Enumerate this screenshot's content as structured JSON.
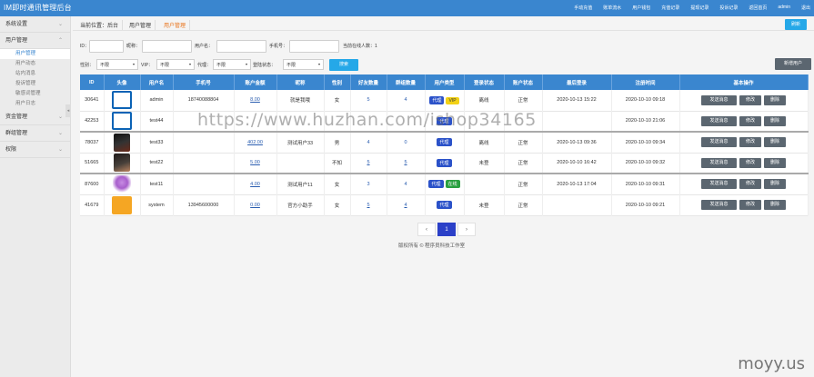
{
  "app": {
    "title": "IM即时通讯管理后台"
  },
  "topnav": [
    "手动充值",
    "账单流水",
    "用户钱包",
    "充值记录",
    "提现记录",
    "投诉记录",
    "返回首页",
    "admin",
    "退出"
  ],
  "sidebar": {
    "groups": [
      {
        "label": "系统设置",
        "chevron": "⌄"
      },
      {
        "label": "用户管理",
        "chevron": "⌃"
      },
      {
        "label": "资金管理",
        "chevron": "⌄"
      },
      {
        "label": "群组管理",
        "chevron": "⌄"
      },
      {
        "label": "权限",
        "chevron": "⌄"
      }
    ],
    "sub_items": [
      "用户管理",
      "用户动态",
      "站内消息",
      "投诉管理",
      "敏感词管理",
      "用户日志"
    ],
    "collapse_arrow": "◂"
  },
  "breadcrumb": [
    "当前位置：后台",
    "用户管理",
    "用户管理"
  ],
  "refresh_label": "刷新",
  "filters": {
    "row1": {
      "id_label": "ID：",
      "nick_label": "昵称：",
      "username_label": "用户名：",
      "phone_label": "手机号：",
      "online_label": "当前在线人数：1"
    },
    "row2": {
      "gender_label": "性别：",
      "gender_value": "不限",
      "vip_label": "VIP：",
      "vip_value": "不限",
      "agent_label": "代理：",
      "agent_value": "不限",
      "status_label": "登陆状态：",
      "status_value": "不限",
      "search_label": "搜索",
      "select_arrow": "▾"
    }
  },
  "add_user_label": "新增用户",
  "table": {
    "headers": [
      "ID",
      "头像",
      "用户名",
      "手机号",
      "账户金额",
      "昵称",
      "性别",
      "好友数量",
      "群组数量",
      "用户类型",
      "登录状态",
      "账户状态",
      "最后登录",
      "注册时间",
      "基本操作"
    ],
    "rows": [
      {
        "id": "30641",
        "avatar": "av-intel",
        "username": "admin",
        "phone": "18740088804",
        "balance": "8.00",
        "nickname": "就是我哦",
        "gender": "女",
        "friends": "5",
        "groups": "4",
        "tags": [
          {
            "t": "代理",
            "c": "blue"
          },
          {
            "t": "VIP",
            "c": "yellow"
          }
        ],
        "login": "离线",
        "account": "正常",
        "last_login": "2020-10-13 15:22",
        "registered": "2020-10-10 09:18",
        "sep": false
      },
      {
        "id": "42253",
        "avatar": "av-intel",
        "username": "test44",
        "phone": "",
        "balance": "",
        "nickname": "",
        "gender": "",
        "friends": "",
        "groups": "",
        "tags": [
          {
            "t": "代理",
            "c": "blue"
          }
        ],
        "login": "",
        "account": "",
        "last_login": "",
        "registered": "2020-10-10 21:06",
        "sep": true
      },
      {
        "id": "78037",
        "avatar": "av-dark",
        "username": "test33",
        "phone": "",
        "balance": "402.00",
        "nickname": "测试用户33",
        "gender": "男",
        "friends": "4",
        "groups": "0",
        "tags": [
          {
            "t": "代理",
            "c": "blue"
          }
        ],
        "login": "离线",
        "account": "正常",
        "last_login": "2020-10-13 09:36",
        "registered": "2020-10-10 09:34",
        "sep": false
      },
      {
        "id": "51665",
        "avatar": "av-dark2",
        "username": "test22",
        "phone": "",
        "balance": "5.00",
        "nickname": "",
        "gender": "不知",
        "friends": "5",
        "groups": "5",
        "tags": [
          {
            "t": "代理",
            "c": "blue"
          }
        ],
        "login": "未登",
        "account": "正常",
        "last_login": "2020-10-10 16:42",
        "registered": "2020-10-10 09:32",
        "sep": true
      },
      {
        "id": "87600",
        "avatar": "av-flower",
        "username": "test11",
        "phone": "",
        "balance": "4.00",
        "nickname": "测试用户11",
        "gender": "女",
        "friends": "3",
        "groups": "4",
        "tags": [
          {
            "t": "代理",
            "c": "blue"
          },
          {
            "t": "在线",
            "c": "green"
          }
        ],
        "login": "",
        "account": "正常",
        "last_login": "2020-10-13 17:04",
        "registered": "2020-10-10 09:31",
        "sep": false
      },
      {
        "id": "41679",
        "avatar": "av-intel-y",
        "username": "system",
        "phone": "13945600000",
        "balance": "0.00",
        "nickname": "官方小助手",
        "gender": "女",
        "friends": "5",
        "groups": "4",
        "tags": [
          {
            "t": "代理",
            "c": "blue"
          }
        ],
        "login": "未登",
        "account": "正常",
        "last_login": "",
        "registered": "2020-10-10 09:21",
        "sep": false
      }
    ],
    "ops": [
      "发送消息",
      "修改",
      "删除"
    ]
  },
  "pagination": {
    "prev": "‹",
    "current": "1",
    "next": "›"
  },
  "footer": "版权所有 © 程序员科技工作室",
  "watermark": "https://www.huzhan.com/ishop34165",
  "corner_watermark": "moyy.us"
}
